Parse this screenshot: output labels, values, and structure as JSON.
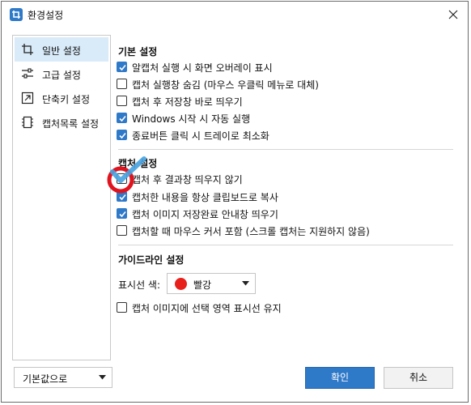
{
  "window": {
    "title": "환경설정"
  },
  "sidebar": {
    "items": [
      {
        "label": "일반 설정",
        "icon": "crop-icon",
        "active": true
      },
      {
        "label": "고급 설정",
        "icon": "sliders-icon",
        "active": false
      },
      {
        "label": "단축키 설정",
        "icon": "shortcut-icon",
        "active": false
      },
      {
        "label": "캡처목록 설정",
        "icon": "list-icon",
        "active": false
      }
    ]
  },
  "sections": {
    "basic": {
      "title": "기본 설정",
      "options": [
        {
          "label": "알캡처 실행 시 화면 오버레이 표시",
          "checked": true
        },
        {
          "label": "캡처 실행창 숨김 (마우스 우클릭 메뉴로 대체)",
          "checked": false
        },
        {
          "label": "캡처 후 저장창 바로 띄우기",
          "checked": false
        },
        {
          "label": "Windows 시작 시 자동 실행",
          "checked": true
        },
        {
          "label": "종료버튼 클릭 시 트레이로 최소화",
          "checked": true
        }
      ]
    },
    "capture": {
      "title": "캡처 설정",
      "options": [
        {
          "label": "캡처 후 결과창 띄우지 않기",
          "checked": false
        },
        {
          "label": "캡처한 내용을 항상 클립보드로 복사",
          "checked": true
        },
        {
          "label": "캡처 이미지 저장완료 안내창 띄우기",
          "checked": true
        },
        {
          "label": "캡처할 때 마우스 커서 포함 (스크롤 캡처는 지원하지 않음)",
          "checked": false
        }
      ]
    },
    "guide": {
      "title": "가이드라인 설정",
      "color_label": "표시선 색:",
      "color_value": "빨강",
      "color_hex": "#e8201b",
      "options": [
        {
          "label": "캡처 이미지에 선택 영역 표시선 유지",
          "checked": false
        }
      ]
    }
  },
  "footer": {
    "defaults_label": "기본값으로",
    "ok_label": "확인",
    "cancel_label": "취소"
  },
  "colors": {
    "accent": "#2f79c9",
    "selection": "#d9ebf9",
    "annotation_circle": "#e0141e",
    "annotation_check": "#4aa3df"
  }
}
